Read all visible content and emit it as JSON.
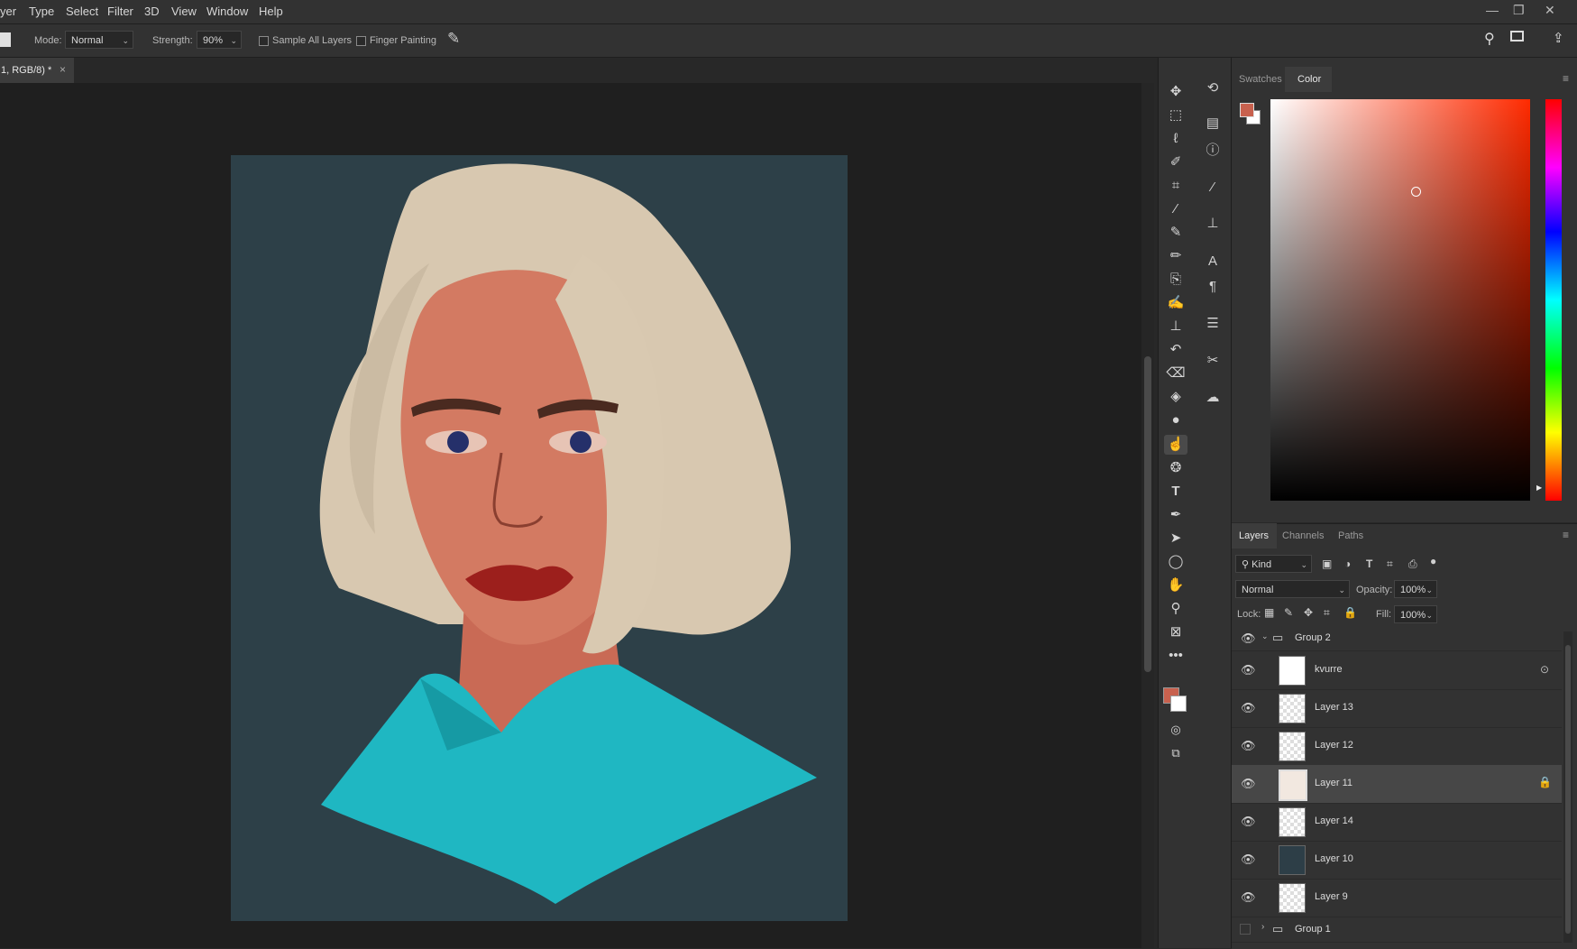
{
  "menu": [
    "yer",
    "Type",
    "Select",
    "Filter",
    "3D",
    "View",
    "Window",
    "Help"
  ],
  "window_controls": [
    "—",
    "❐",
    "✕"
  ],
  "options": {
    "mode_label": "Mode:",
    "mode_value": "Normal",
    "strength_label": "Strength:",
    "strength_value": "90%",
    "sample_all_layers": "Sample All Layers",
    "finger_painting": "Finger Painting"
  },
  "document_tab": {
    "title": "1, RGB/8) *",
    "close": "×"
  },
  "color_panel": {
    "tabs": [
      "Swatches",
      "Color"
    ],
    "active_tab": "Color",
    "foreground_color": "#c8614e",
    "background_color": "#ffffff"
  },
  "layers_panel": {
    "tabs": [
      "Layers",
      "Channels",
      "Paths"
    ],
    "filter_label": "Kind",
    "blend_mode": "Normal",
    "opacity_label": "Opacity:",
    "opacity_value": "100%",
    "lock_label": "Lock:",
    "fill_label": "Fill:",
    "fill_value": "100%",
    "layers": [
      {
        "name": "Group 2",
        "type": "group",
        "expanded": true,
        "visible": true
      },
      {
        "name": "kvurre",
        "type": "layer",
        "visible": true
      },
      {
        "name": "Layer 13",
        "type": "layer",
        "visible": true
      },
      {
        "name": "Layer 12",
        "type": "layer",
        "visible": true
      },
      {
        "name": "Layer 11",
        "type": "layer",
        "visible": true,
        "selected": true,
        "locked": true
      },
      {
        "name": "Layer 14",
        "type": "layer",
        "visible": true
      },
      {
        "name": "Layer 10",
        "type": "layer",
        "visible": true
      },
      {
        "name": "Layer 9",
        "type": "layer",
        "visible": true
      },
      {
        "name": "Group 1",
        "type": "group",
        "expanded": false,
        "visible": false
      }
    ]
  },
  "icons": {
    "toolbar": [
      "move-icon",
      "marquee-icon",
      "lasso-icon",
      "quick-select-icon",
      "crop-icon",
      "eyedropper-icon",
      "brush-icon",
      "pencil-icon",
      "clone-icon",
      "mixer-brush-icon",
      "stamp-icon",
      "history-brush-icon",
      "eraser-icon",
      "paint-bucket-icon",
      "blur-icon",
      "smudge-icon",
      "sponge-icon",
      "type-icon",
      "pen-icon",
      "path-select-icon",
      "ellipse-icon",
      "hand-icon",
      "zoom-icon",
      "frame-icon",
      "more-icon"
    ],
    "dock": [
      "history-icon",
      "properties-icon",
      "info-icon",
      "brush-settings-icon",
      "clone-source-icon",
      "character-icon",
      "paragraph-icon",
      "adjustments-icon",
      "tools-icon",
      "libraries-icon"
    ]
  }
}
